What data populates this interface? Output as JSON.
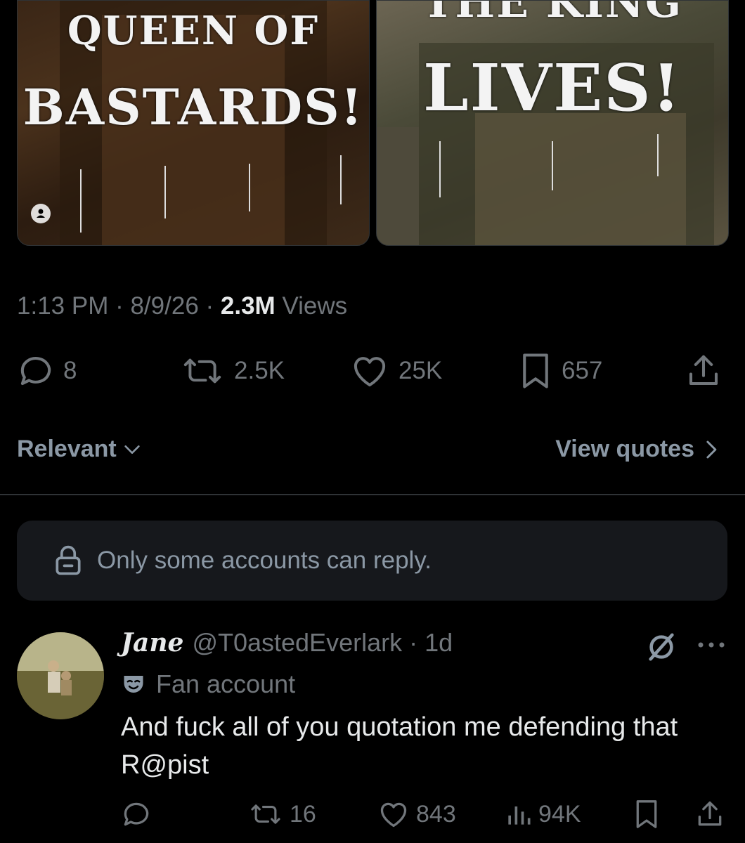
{
  "media": {
    "left_text_line1": "QUEEN OF",
    "left_text_line2": "BASTARDS!",
    "right_text_line1": "THE KING",
    "right_text_line2": "LIVES!"
  },
  "tweet": {
    "time": "1:13 PM",
    "date": "8/9/26",
    "views_count": "2.3M",
    "views_label": "Views",
    "replies": "8",
    "reposts": "2.5K",
    "likes": "25K",
    "bookmarks": "657"
  },
  "sort": {
    "label": "Relevant",
    "quotes_label": "View quotes"
  },
  "notice": {
    "text": "Only some accounts can reply."
  },
  "reply": {
    "name": "Jane",
    "handle": "@T0astedEverlark",
    "time": "1d",
    "label": "Fan account",
    "text": "And fuck all of you quotation me defending that R@pist",
    "reposts": "16",
    "likes": "843",
    "views": "94K"
  },
  "colors": {
    "background": "#000000",
    "muted": "#71767b",
    "text": "#e7e9ea",
    "panel": "#16181c"
  }
}
